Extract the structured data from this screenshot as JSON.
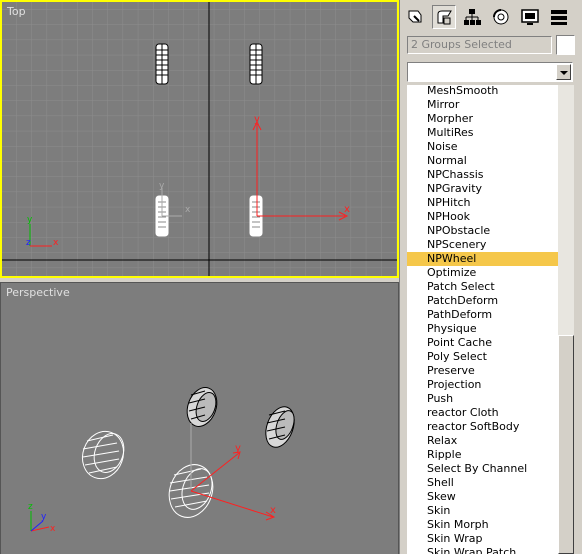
{
  "viewports": {
    "top_label": "Top",
    "perspective_label": "Perspective"
  },
  "command_panel": {
    "tabs": [
      {
        "icon": "create-icon"
      },
      {
        "icon": "modify-icon"
      },
      {
        "icon": "hierarchy-icon"
      },
      {
        "icon": "motion-icon"
      },
      {
        "icon": "display-icon"
      },
      {
        "icon": "utilities-icon"
      }
    ],
    "selection_text": "2 Groups Selected",
    "modifier_dropdown_value": "",
    "modifiers": [
      "MeshSmooth",
      "Mirror",
      "Morpher",
      "MultiRes",
      "Noise",
      "Normal",
      "NPChassis",
      "NPGravity",
      "NPHitch",
      "NPHook",
      "NPObstacle",
      "NPScenery",
      "NPWheel",
      "Optimize",
      "Patch Select",
      "PatchDeform",
      "PathDeform",
      "Physique",
      "Point Cache",
      "Poly Select",
      "Preserve",
      "Projection",
      "Push",
      "reactor Cloth",
      "reactor SoftBody",
      "Relax",
      "Ripple",
      "Select By Channel",
      "Shell",
      "Skew",
      "Skin",
      "Skin Morph",
      "Skin Wrap",
      "Skin Wrap Patch"
    ],
    "selected_modifier": "NPWheel"
  },
  "colors": {
    "viewport_bg": "#7d7d7d",
    "active_border": "#ffff00",
    "selection_highlight": "#f5c74a",
    "gizmo_red": "#ff2020"
  }
}
